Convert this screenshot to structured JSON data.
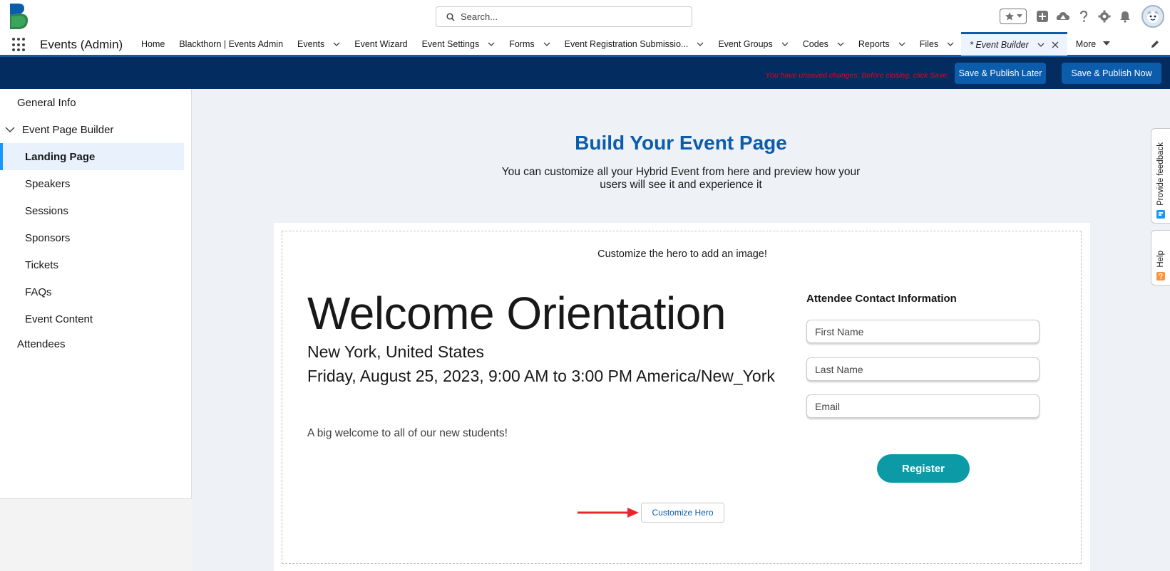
{
  "global_header": {
    "search_placeholder": "Search...",
    "icons": [
      "favorites-star-icon",
      "favorites-dropdown-icon",
      "global-actions-add-icon",
      "trailhead-icon",
      "help-icon",
      "setup-gear-icon",
      "notifications-bell-icon",
      "user-avatar"
    ]
  },
  "nav": {
    "app_name": "Events (Admin)",
    "items": [
      {
        "label": "Home",
        "has_menu": false
      },
      {
        "label": "Blackthorn | Events Admin",
        "has_menu": false
      },
      {
        "label": "Events",
        "has_menu": true
      },
      {
        "label": "Event Wizard",
        "has_menu": false
      },
      {
        "label": "Event Settings",
        "has_menu": true
      },
      {
        "label": "Forms",
        "has_menu": true
      },
      {
        "label": "Event Registration Submissio...",
        "has_menu": true
      },
      {
        "label": "Event Groups",
        "has_menu": true
      },
      {
        "label": "Codes",
        "has_menu": true
      },
      {
        "label": "Reports",
        "has_menu": true
      },
      {
        "label": "Files",
        "has_menu": true
      }
    ],
    "active_tab": "* Event Builder",
    "more_label": "More"
  },
  "toolbar": {
    "unsaved_message": "You have unsaved changes. Before closing, click Save.",
    "save_later_label": "Save & Publish Later",
    "save_now_label": "Save & Publish Now"
  },
  "sidebar": {
    "general_info": "General Info",
    "page_builder": "Event Page Builder",
    "pages": [
      "Landing Page",
      "Speakers",
      "Sessions",
      "Sponsors",
      "Tickets",
      "FAQs",
      "Event Content"
    ],
    "selected_page": "Landing Page",
    "attendees": "Attendees"
  },
  "main": {
    "title": "Build Your Event Page",
    "subtitle": "You can customize all your Hybrid Event from here and preview how your users will see it and experience it",
    "hero_hint": "Customize the hero to add an image!",
    "event_name": "Welcome Orientation",
    "location": "New York, United States",
    "datetime": "Friday, August 25, 2023, 9:00 AM to 3:00 PM America/New_York",
    "description": "A big welcome to all of our new students!",
    "form": {
      "title": "Attendee Contact Information",
      "fields": [
        {
          "label": "First Name",
          "value": ""
        },
        {
          "label": "Last Name",
          "value": ""
        },
        {
          "label": "Email",
          "value": ""
        }
      ],
      "register_label": "Register"
    },
    "customize_hero_label": "Customize Hero"
  },
  "utility_tabs": {
    "feedback": "Provide feedback",
    "help": "Help"
  },
  "colors": {
    "brand_blue": "#0b5cab",
    "toolbar_navy": "#032d60",
    "register_teal": "#0b9aa6",
    "unsaved_red": "#ea001e",
    "annotation_arrow": "#e8262b"
  }
}
